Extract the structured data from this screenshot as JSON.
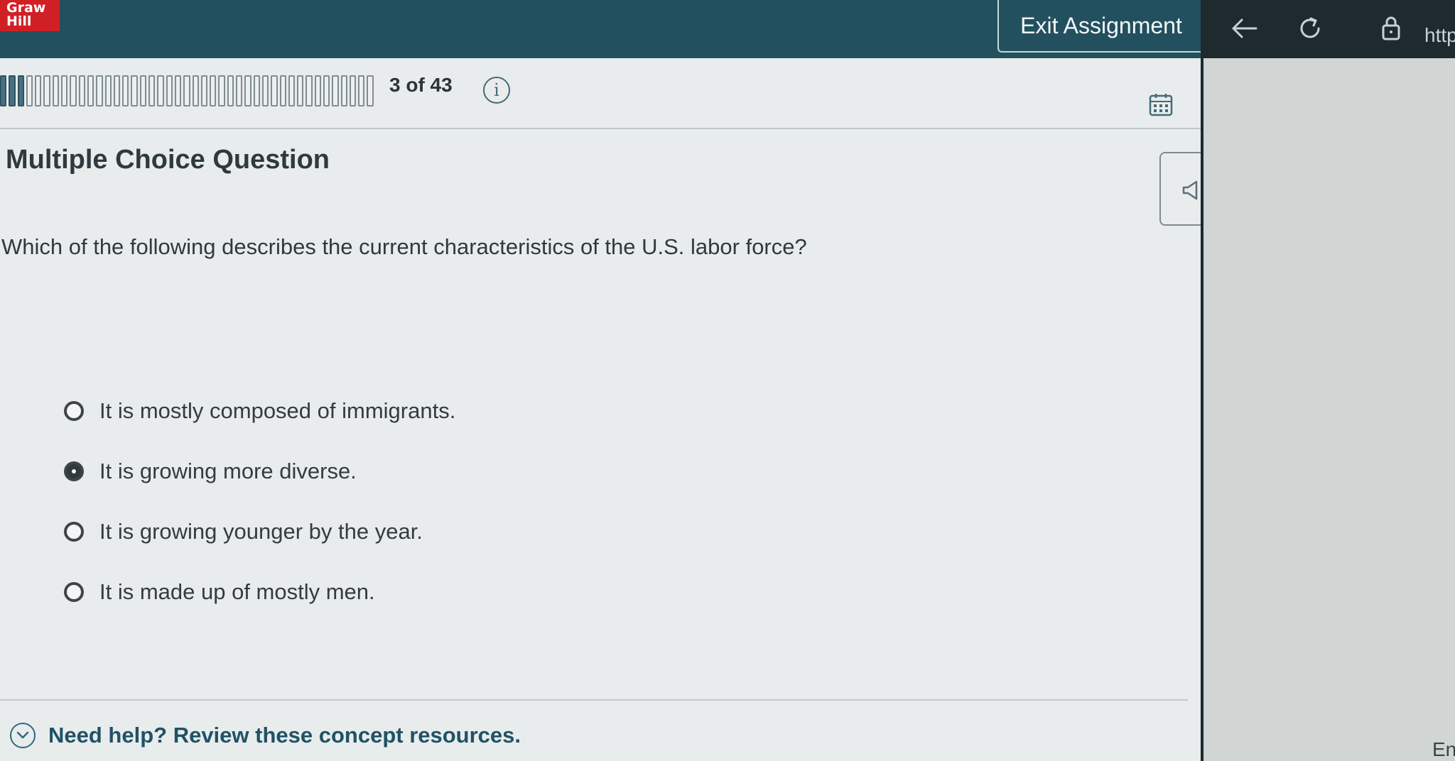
{
  "header": {
    "logo_text": "Graw\nHill",
    "exit_label": "Exit Assignment",
    "brand_color": "#d11f26",
    "bar_color": "#22505e"
  },
  "progress": {
    "counter": "3 of 43",
    "current": 3,
    "total": 43
  },
  "question": {
    "type_label": "Multiple Choice Question",
    "prompt": "Which of the following describes the current characteristics of the U.S. labor force?"
  },
  "options": [
    {
      "label": "It is mostly composed of immigrants.",
      "selected": false
    },
    {
      "label": "It is growing more diverse.",
      "selected": true
    },
    {
      "label": "It is growing younger by the year.",
      "selected": false
    },
    {
      "label": "It is made up of mostly men.",
      "selected": false
    }
  ],
  "help": {
    "label": "Need help? Review these concept resources."
  },
  "browser": {
    "url_text": "http",
    "side_text": "En"
  },
  "icons": {
    "info": "info-icon",
    "calculator": "calculator-icon",
    "back": "arrow-left-icon",
    "reload": "reload-icon",
    "lock": "lock-icon",
    "help": "chevron-down-icon",
    "side": "speaker-icon"
  }
}
